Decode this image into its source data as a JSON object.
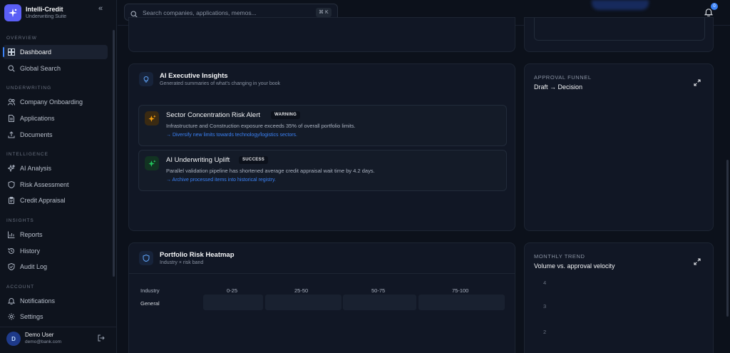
{
  "brand": {
    "title": "Intelli-Credit",
    "subtitle": "Underwriting Suite"
  },
  "sidebar": {
    "sections": [
      {
        "label": "OVERVIEW",
        "items": [
          {
            "label": "Dashboard",
            "icon": "dashboard-icon",
            "active": true
          },
          {
            "label": "Global Search",
            "icon": "search-icon"
          }
        ]
      },
      {
        "label": "UNDERWRITING",
        "items": [
          {
            "label": "Company Onboarding",
            "icon": "users-icon"
          },
          {
            "label": "Applications",
            "icon": "file-icon"
          },
          {
            "label": "Documents",
            "icon": "upload-icon"
          }
        ]
      },
      {
        "label": "INTELLIGENCE",
        "items": [
          {
            "label": "AI Analysis",
            "icon": "sparkles-icon"
          },
          {
            "label": "Risk Assessment",
            "icon": "shield-icon"
          },
          {
            "label": "Credit Appraisal",
            "icon": "clipboard-icon"
          }
        ]
      },
      {
        "label": "INSIGHTS",
        "items": [
          {
            "label": "Reports",
            "icon": "bar-chart-icon"
          },
          {
            "label": "History",
            "icon": "history-icon"
          },
          {
            "label": "Audit Log",
            "icon": "shield-check-icon"
          }
        ]
      },
      {
        "label": "ACCOUNT",
        "items": [
          {
            "label": "Notifications",
            "icon": "bell-icon"
          },
          {
            "label": "Settings",
            "icon": "gear-icon"
          }
        ]
      }
    ]
  },
  "user": {
    "initial": "D",
    "name": "Demo User",
    "email": "demo@bank.com"
  },
  "search": {
    "placeholder": "Search companies, applications, memos...",
    "shortcut": "⌘ K"
  },
  "notifications": {
    "count": "0"
  },
  "insights": {
    "title": "AI Executive Insights",
    "subtitle": "Generated summaries of what's changing in your book",
    "items": [
      {
        "title": "Sector Concentration Risk Alert",
        "badge": "WARNING",
        "description": "Infrastructure and Construction exposure exceeds 35% of overall portfolio limits.",
        "action": "→ Diversify new limits towards technology/logistics sectors.",
        "color": "#f59e0b"
      },
      {
        "title": "AI Underwriting Uplift",
        "badge": "SUCCESS",
        "description": "Parallel validation pipeline has shortened average credit appraisal wait time by 4.2 days.",
        "action": "→ Archive processed items into historical registry.",
        "color": "#22c55e"
      }
    ]
  },
  "funnel": {
    "label": "APPROVAL FUNNEL",
    "title": "Draft → Decision"
  },
  "heatmap": {
    "title": "Portfolio Risk Heatmap",
    "subtitle": "Industry × risk band",
    "columns": [
      "Industry",
      "0-25",
      "25-50",
      "50-75",
      "75-100"
    ],
    "rows": [
      {
        "industry": "General"
      }
    ]
  },
  "trend": {
    "label": "MONTHLY TREND",
    "title": "Volume vs. approval velocity",
    "yticks": [
      "4",
      "3",
      "2"
    ]
  },
  "colors": {
    "accent": "#3b82f6",
    "brand": "#5b5ff6",
    "warning": "#f59e0b",
    "success": "#22c55e"
  }
}
